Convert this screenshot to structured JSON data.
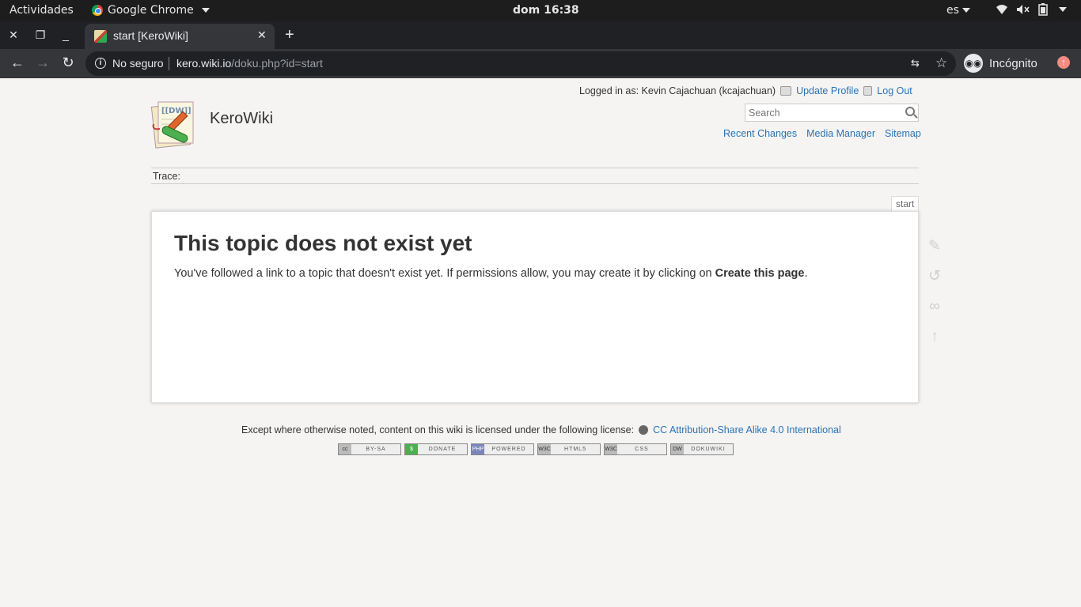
{
  "system_bar": {
    "activities": "Actividades",
    "app_name": "Google Chrome",
    "clock": "dom 16:38",
    "language": "es"
  },
  "browser": {
    "tab_title": "start [KeroWiki]",
    "security_label": "No seguro",
    "url_host": "kero.wiki.io",
    "url_path": "/doku.php?id=start",
    "incognito_label": "Incógnito"
  },
  "wiki": {
    "logged_in": "Logged in as: Kevin Cajachuan (kcajachuan)",
    "update_profile": "Update Profile",
    "log_out": "Log Out",
    "search_placeholder": "Search",
    "site_title": "KeroWiki",
    "site_tools": [
      "Recent Changes",
      "Media Manager",
      "Sitemap"
    ],
    "trace_label": "Trace:",
    "page_id": "start",
    "heading": "This topic does not exist yet",
    "message_prefix": "You've followed a link to a topic that doesn't exist yet. If permissions allow, you may create it by clicking on ",
    "message_link": "Create this page",
    "message_suffix": ".",
    "license_text": "Except where otherwise noted, content on this wiki is licensed under the following license:",
    "license_link": "CC Attribution-Share Alike 4.0 International",
    "badges": [
      {
        "left": "cc",
        "right": "BY-SA"
      },
      {
        "left": "$",
        "right": "DONATE"
      },
      {
        "left": "PHP",
        "right": "POWERED"
      },
      {
        "left": "W3C",
        "right": "HTML5"
      },
      {
        "left": "W3C",
        "right": "CSS"
      },
      {
        "left": "DW",
        "right": "DOKUWIKI"
      }
    ]
  }
}
